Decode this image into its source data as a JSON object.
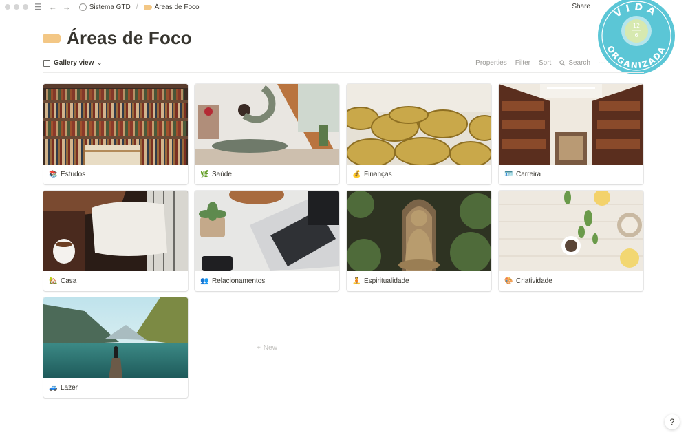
{
  "topbar": {
    "breadcrumb_root": "Sistema GTD",
    "breadcrumb_separator": "/",
    "breadcrumb_current": "Áreas de Foco",
    "share_label": "Share"
  },
  "logo": {
    "text_top": "VIDA",
    "text_bottom": "ORGANIZADA",
    "badge_top": "12",
    "badge_bottom": "6"
  },
  "page": {
    "title": "Áreas de Foco"
  },
  "view": {
    "name": "Gallery view",
    "properties": "Properties",
    "filter": "Filter",
    "sort": "Sort",
    "search": "Search",
    "more": "···"
  },
  "cards": [
    {
      "label": "Estudos",
      "icon": "books-icon",
      "emoji": "📚"
    },
    {
      "label": "Saúde",
      "icon": "herb-icon",
      "emoji": "🌿"
    },
    {
      "label": "Finanças",
      "icon": "money-bag-icon",
      "emoji": "💰"
    },
    {
      "label": "Carreira",
      "icon": "id-card-icon",
      "emoji": "🪪"
    },
    {
      "label": "Casa",
      "icon": "house-icon",
      "emoji": "🏡"
    },
    {
      "label": "Relacionamentos",
      "icon": "people-icon",
      "emoji": "👥"
    },
    {
      "label": "Espiritualidade",
      "icon": "meditation-icon",
      "emoji": "🧘"
    },
    {
      "label": "Criatividade",
      "icon": "palette-icon",
      "emoji": "🎨"
    },
    {
      "label": "Lazer",
      "icon": "car-icon",
      "emoji": "🚙"
    }
  ],
  "new_label": "New",
  "help_label": "?"
}
